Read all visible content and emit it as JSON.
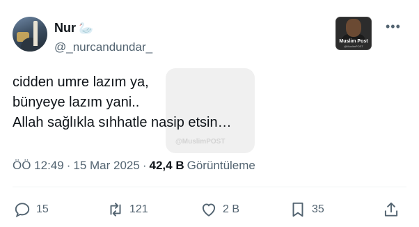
{
  "author": {
    "name": "Nur",
    "emoji": "🦢",
    "handle": "@_nurcandundar_"
  },
  "badge": {
    "title": "Muslim Post",
    "handle": "@MuslimPOST"
  },
  "more_label": "•••",
  "tweet": {
    "lines": [
      "cidden umre lazım ya,",
      "bünyeye lazım yani..",
      "Allah sağlıkla sıhhatle nasip etsin…"
    ]
  },
  "watermark": "@MuslimPOST",
  "meta": {
    "time": "ÖÖ 12:49",
    "separator": "·",
    "date": "15 Mar 2025",
    "views_count": "42,4 B",
    "views_label": "Görüntüleme"
  },
  "actions": {
    "replies": "15",
    "retweets": "121",
    "likes": "2 B",
    "bookmarks": "35"
  },
  "icons": [
    "swan-icon",
    "more-icon",
    "reply-icon",
    "retweet-icon",
    "like-icon",
    "bookmark-icon",
    "share-icon"
  ],
  "colors": {
    "text": "#0f1419",
    "secondary": "#536471"
  }
}
